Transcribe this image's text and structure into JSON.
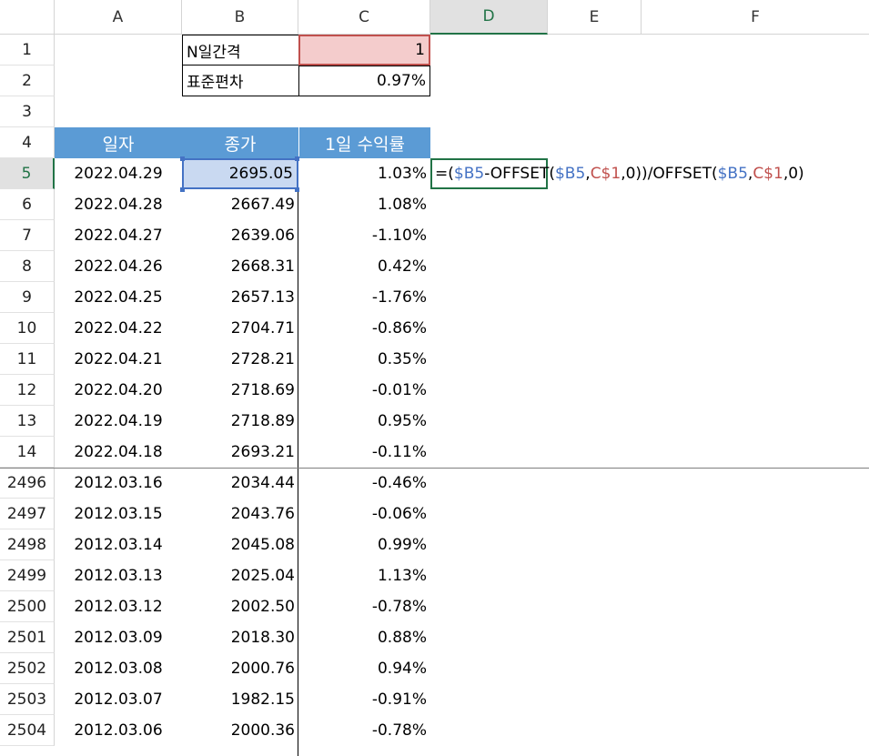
{
  "columns": [
    "A",
    "B",
    "C",
    "D",
    "E",
    "F"
  ],
  "top_rows": [
    "1",
    "2",
    "3",
    "4",
    "5",
    "6",
    "7",
    "8",
    "9",
    "10",
    "11",
    "12",
    "13",
    "14"
  ],
  "bottom_rows": [
    "2496",
    "2497",
    "2498",
    "2499",
    "2500",
    "2501",
    "2502",
    "2503",
    "2504"
  ],
  "params": {
    "n_label": "N일간격",
    "n_value": "1",
    "sd_label": "표준편차",
    "sd_value": "0.97%"
  },
  "table_header": {
    "date": "일자",
    "close": "종가",
    "ret": "1일 수익률"
  },
  "formula": {
    "p1": "=(",
    "p2": "$B5",
    "p3": "-OFFSET(",
    "p4": "$B5",
    "p5": ",",
    "p6": "C$1",
    "p7": ",0))/OFFSET(",
    "p8": "$B5",
    "p9": ",",
    "p10": "C$1",
    "p11": ",0)"
  },
  "rows_top": [
    {
      "date": "2022.04.29",
      "close": "2695.05",
      "ret": "1.03%"
    },
    {
      "date": "2022.04.28",
      "close": "2667.49",
      "ret": "1.08%"
    },
    {
      "date": "2022.04.27",
      "close": "2639.06",
      "ret": "-1.10%"
    },
    {
      "date": "2022.04.26",
      "close": "2668.31",
      "ret": "0.42%"
    },
    {
      "date": "2022.04.25",
      "close": "2657.13",
      "ret": "-1.76%"
    },
    {
      "date": "2022.04.22",
      "close": "2704.71",
      "ret": "-0.86%"
    },
    {
      "date": "2022.04.21",
      "close": "2728.21",
      "ret": "0.35%"
    },
    {
      "date": "2022.04.20",
      "close": "2718.69",
      "ret": "-0.01%"
    },
    {
      "date": "2022.04.19",
      "close": "2718.89",
      "ret": "0.95%"
    },
    {
      "date": "2022.04.18",
      "close": "2693.21",
      "ret": "-0.11%"
    }
  ],
  "rows_bottom": [
    {
      "date": "2012.03.16",
      "close": "2034.44",
      "ret": "-0.46%"
    },
    {
      "date": "2012.03.15",
      "close": "2043.76",
      "ret": "-0.06%"
    },
    {
      "date": "2012.03.14",
      "close": "2045.08",
      "ret": "0.99%"
    },
    {
      "date": "2012.03.13",
      "close": "2025.04",
      "ret": "1.13%"
    },
    {
      "date": "2012.03.12",
      "close": "2002.50",
      "ret": "-0.78%"
    },
    {
      "date": "2012.03.09",
      "close": "2018.30",
      "ret": "0.88%"
    },
    {
      "date": "2012.03.08",
      "close": "2000.76",
      "ret": "0.94%"
    },
    {
      "date": "2012.03.07",
      "close": "1982.15",
      "ret": "-0.91%"
    },
    {
      "date": "2012.03.06",
      "close": "2000.36",
      "ret": "-0.78%"
    }
  ],
  "colors": {
    "header_fill": "#5b9bd5",
    "input_fill": "#f4cccc",
    "input_border": "#c0504d",
    "selected_fill": "#c9d9f1",
    "ref_blue": "#4472c4",
    "ref_red": "#c0504d",
    "active_green": "#217346"
  }
}
